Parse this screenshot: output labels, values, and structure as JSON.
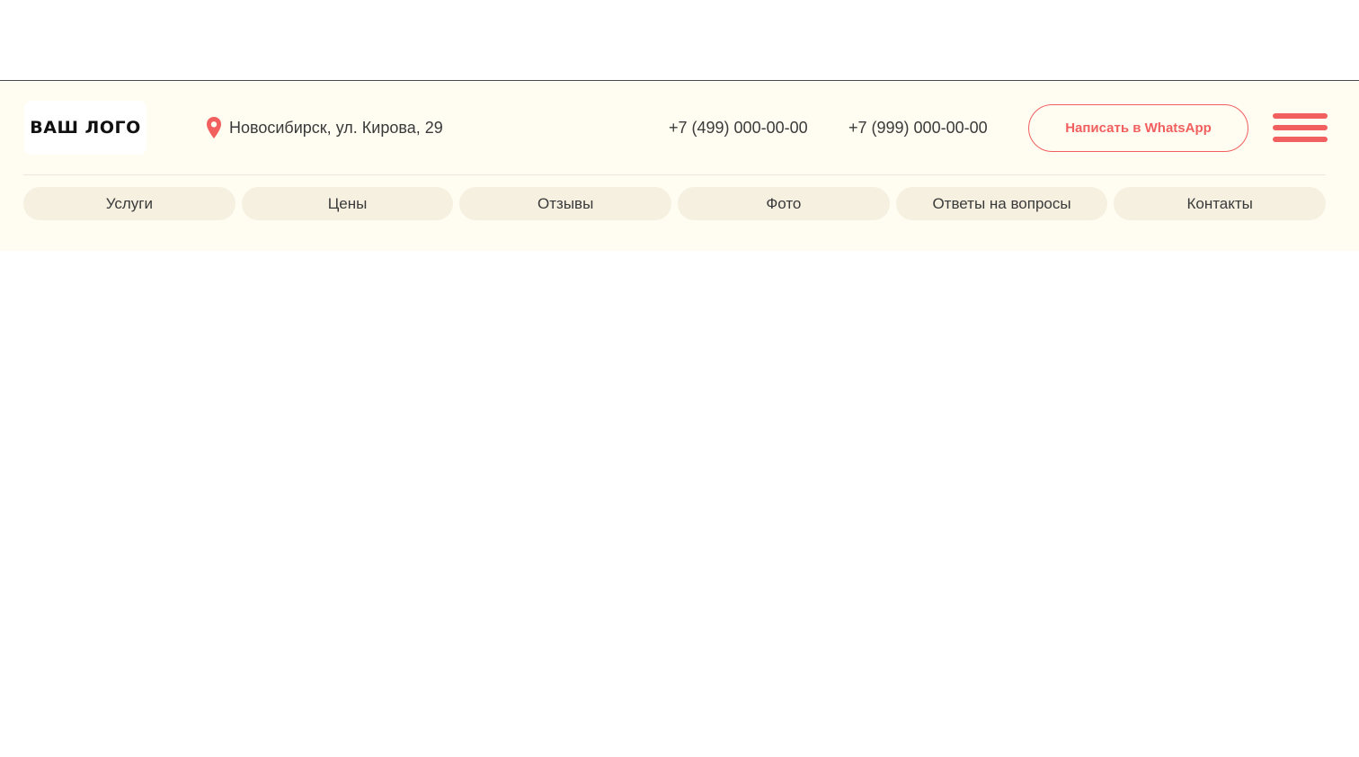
{
  "header": {
    "logo_text": "ВАШ ЛОГО",
    "address": "Новосибирск, ул. Кирова, 29",
    "phone_1": "+7 (499) 000-00-00",
    "phone_2": "+7 (999) 000-00-00",
    "whatsapp_label": "Написать в WhatsApp",
    "icons": {
      "address": "map-pin-icon",
      "menu": "hamburger-menu-icon"
    }
  },
  "nav": {
    "items": [
      {
        "label": "Услуги"
      },
      {
        "label": "Цены"
      },
      {
        "label": "Отзывы"
      },
      {
        "label": "Фото"
      },
      {
        "label": "Ответы на вопросы"
      },
      {
        "label": "Контакты"
      }
    ]
  },
  "colors": {
    "header_background": "#fffdf1",
    "accent": "#f15f5f",
    "nav_pill": "#f5f0e0",
    "text": "#3a3a3a"
  }
}
